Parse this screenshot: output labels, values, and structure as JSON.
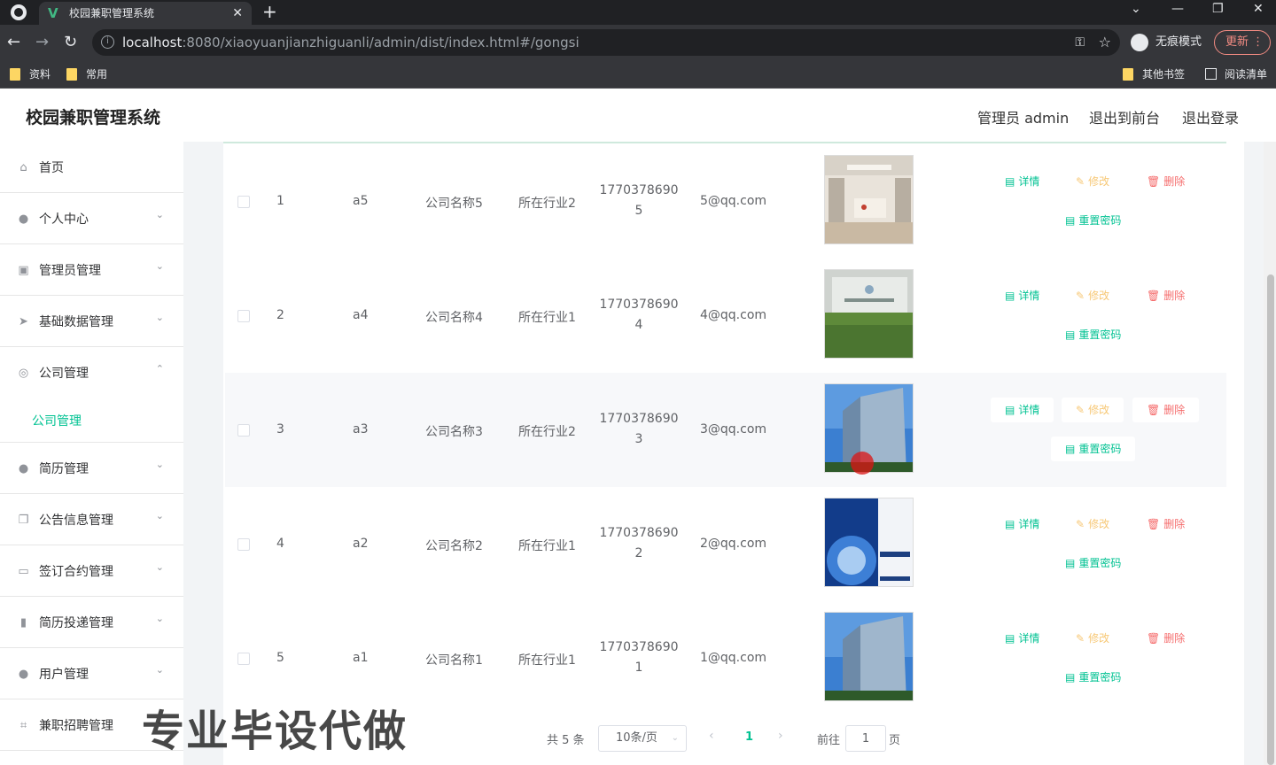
{
  "browser": {
    "tab_title": "校园兼职管理系统",
    "url_host": "localhost",
    "url_rest": ":8080/xiaoyuanjianzhiguanli/admin/dist/index.html#/gongsi",
    "incognito_label": "无痕模式",
    "update_label": "更新",
    "bookmarks": [
      "资料",
      "常用"
    ],
    "bookmarks_right": [
      "其他书签",
      "阅读清单"
    ]
  },
  "header": {
    "title": "校园兼职管理系统",
    "user": "管理员 admin",
    "to_front": "退出到前台",
    "logout": "退出登录"
  },
  "sidebar": {
    "items": [
      {
        "label": "首页",
        "icon": "home-icon"
      },
      {
        "label": "个人中心",
        "icon": "user-icon"
      },
      {
        "label": "管理员管理",
        "icon": "chart-icon"
      },
      {
        "label": "基础数据管理",
        "icon": "send-icon"
      },
      {
        "label": "公司管理",
        "icon": "company-icon"
      },
      {
        "label": "简历管理",
        "icon": "user-icon"
      },
      {
        "label": "公告信息管理",
        "icon": "copy-icon"
      },
      {
        "label": "签订合约管理",
        "icon": "contract-icon"
      },
      {
        "label": "简历投递管理",
        "icon": "bar-chart-icon"
      },
      {
        "label": "用户管理",
        "icon": "user-icon"
      },
      {
        "label": "兼职招聘管理",
        "icon": "crop-icon"
      }
    ],
    "active_sub": "公司管理"
  },
  "table": {
    "rows": [
      {
        "index": "1",
        "account": "a5",
        "name": "公司名称5",
        "industry": "所在行业2",
        "phone1": "1770378690",
        "phone2": "5",
        "email": "5@qq.com"
      },
      {
        "index": "2",
        "account": "a4",
        "name": "公司名称4",
        "industry": "所在行业1",
        "phone1": "1770378690",
        "phone2": "4",
        "email": "4@qq.com"
      },
      {
        "index": "3",
        "account": "a3",
        "name": "公司名称3",
        "industry": "所在行业2",
        "phone1": "1770378690",
        "phone2": "3",
        "email": "3@qq.com"
      },
      {
        "index": "4",
        "account": "a2",
        "name": "公司名称2",
        "industry": "所在行业1",
        "phone1": "1770378690",
        "phone2": "2",
        "email": "2@qq.com"
      },
      {
        "index": "5",
        "account": "a1",
        "name": "公司名称1",
        "industry": "所在行业1",
        "phone1": "1770378690",
        "phone2": "1",
        "email": "1@qq.com"
      }
    ],
    "actions": {
      "detail": "详情",
      "edit": "修改",
      "delete": "删除",
      "reset": "重置密码"
    }
  },
  "pagination": {
    "total": "共 5 条",
    "page_size": "10条/页",
    "current": "1",
    "goto_label": "前往",
    "goto_value": "1",
    "unit": "页"
  },
  "watermark": "专业毕设代做",
  "colors": {
    "accent": "#00c292",
    "edit": "#f7c876",
    "danger": "#f56c6c"
  }
}
